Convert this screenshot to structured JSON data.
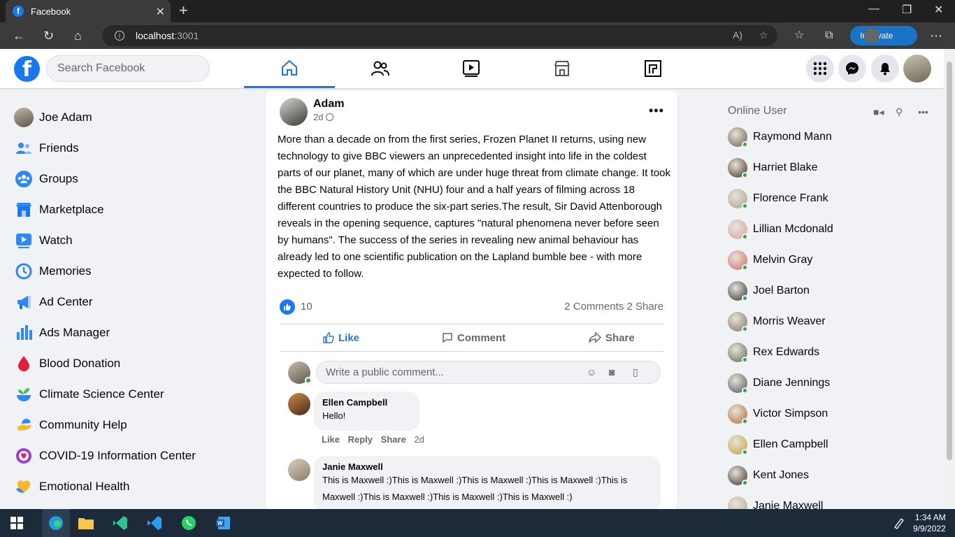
{
  "browser": {
    "tab_title": "Facebook",
    "url_host": "localhost",
    "url_port": ":3001",
    "inprivate_label": "InPrivate"
  },
  "header": {
    "search_placeholder": "Search Facebook"
  },
  "sidebar": {
    "items": [
      {
        "label": "Joe Adam",
        "icon": "user-avatar"
      },
      {
        "label": "Friends",
        "icon": "friends-icon"
      },
      {
        "label": "Groups",
        "icon": "groups-icon"
      },
      {
        "label": "Marketplace",
        "icon": "marketplace-icon"
      },
      {
        "label": "Watch",
        "icon": "watch-icon"
      },
      {
        "label": "Memories",
        "icon": "memories-icon"
      },
      {
        "label": "Ad Center",
        "icon": "ad-center-icon"
      },
      {
        "label": "Ads Manager",
        "icon": "ads-manager-icon"
      },
      {
        "label": "Blood Donation",
        "icon": "blood-donation-icon"
      },
      {
        "label": "Climate Science Center",
        "icon": "climate-icon"
      },
      {
        "label": "Community Help",
        "icon": "community-help-icon"
      },
      {
        "label": "COVID-19 Information Center",
        "icon": "covid-icon"
      },
      {
        "label": "Emotional Health",
        "icon": "emotional-health-icon"
      }
    ]
  },
  "post": {
    "author": "Adam",
    "time": "2d",
    "text": "More than a decade on from the first series, Frozen Planet II returns, using new technology to give BBC viewers an unprecedented insight into life in the coldest parts of our planet, many of which are under huge threat from climate change. It took the BBC Natural History Unit (NHU) four and a half years of filming across 18 different countries to produce the six-part series.The result, Sir David Attenborough reveals in the opening sequence, captures \"natural phenomena never before seen by humans\". The success of the series in revealing new animal behaviour has already led to one scientific publication on the Lapland bumble bee - with more expected to follow.",
    "like_count": "10",
    "comments_count": "2 Comments",
    "share_count": "2 Share",
    "like_label": "Like",
    "comment_label": "Comment",
    "share_label": "Share",
    "comment_placeholder": "Write a public comment...",
    "comments": [
      {
        "name": "Ellen Campbell",
        "text": "Hello!",
        "like": "Like",
        "reply": "Reply",
        "share": "Share",
        "time": "2d"
      },
      {
        "name": "Janie Maxwell",
        "text": "This is Maxwell :)This is Maxwell :)This is Maxwell :)This is Maxwell :)This is Maxwell :)This is Maxwell :)This is Maxwell :)This is Maxwell :)"
      }
    ]
  },
  "online": {
    "title": "Online User",
    "users": [
      {
        "name": "Raymond Mann",
        "color": "#6b5a48"
      },
      {
        "name": "Harriet Blake",
        "color": "#3d3128"
      },
      {
        "name": "Florence Frank",
        "color": "#a79e90"
      },
      {
        "name": "Lillian Mcdonald",
        "color": "#d8a0a4"
      },
      {
        "name": "Melvin Gray",
        "color": "#c96a6a"
      },
      {
        "name": "Joel Barton",
        "color": "#2e3137"
      },
      {
        "name": "Morris Weaver",
        "color": "#7a7466"
      },
      {
        "name": "Rex Edwards",
        "color": "#556b55"
      },
      {
        "name": "Diane Jennings",
        "color": "#4a5561"
      },
      {
        "name": "Victor Simpson",
        "color": "#b46a3a"
      },
      {
        "name": "Ellen Campbell",
        "color": "#c4a23d"
      },
      {
        "name": "Kent Jones",
        "color": "#3a2e27"
      },
      {
        "name": "Janie Maxwell",
        "color": "#b7aa92"
      }
    ]
  },
  "taskbar": {
    "time": "1:34 AM",
    "date": "9/9/2022"
  }
}
